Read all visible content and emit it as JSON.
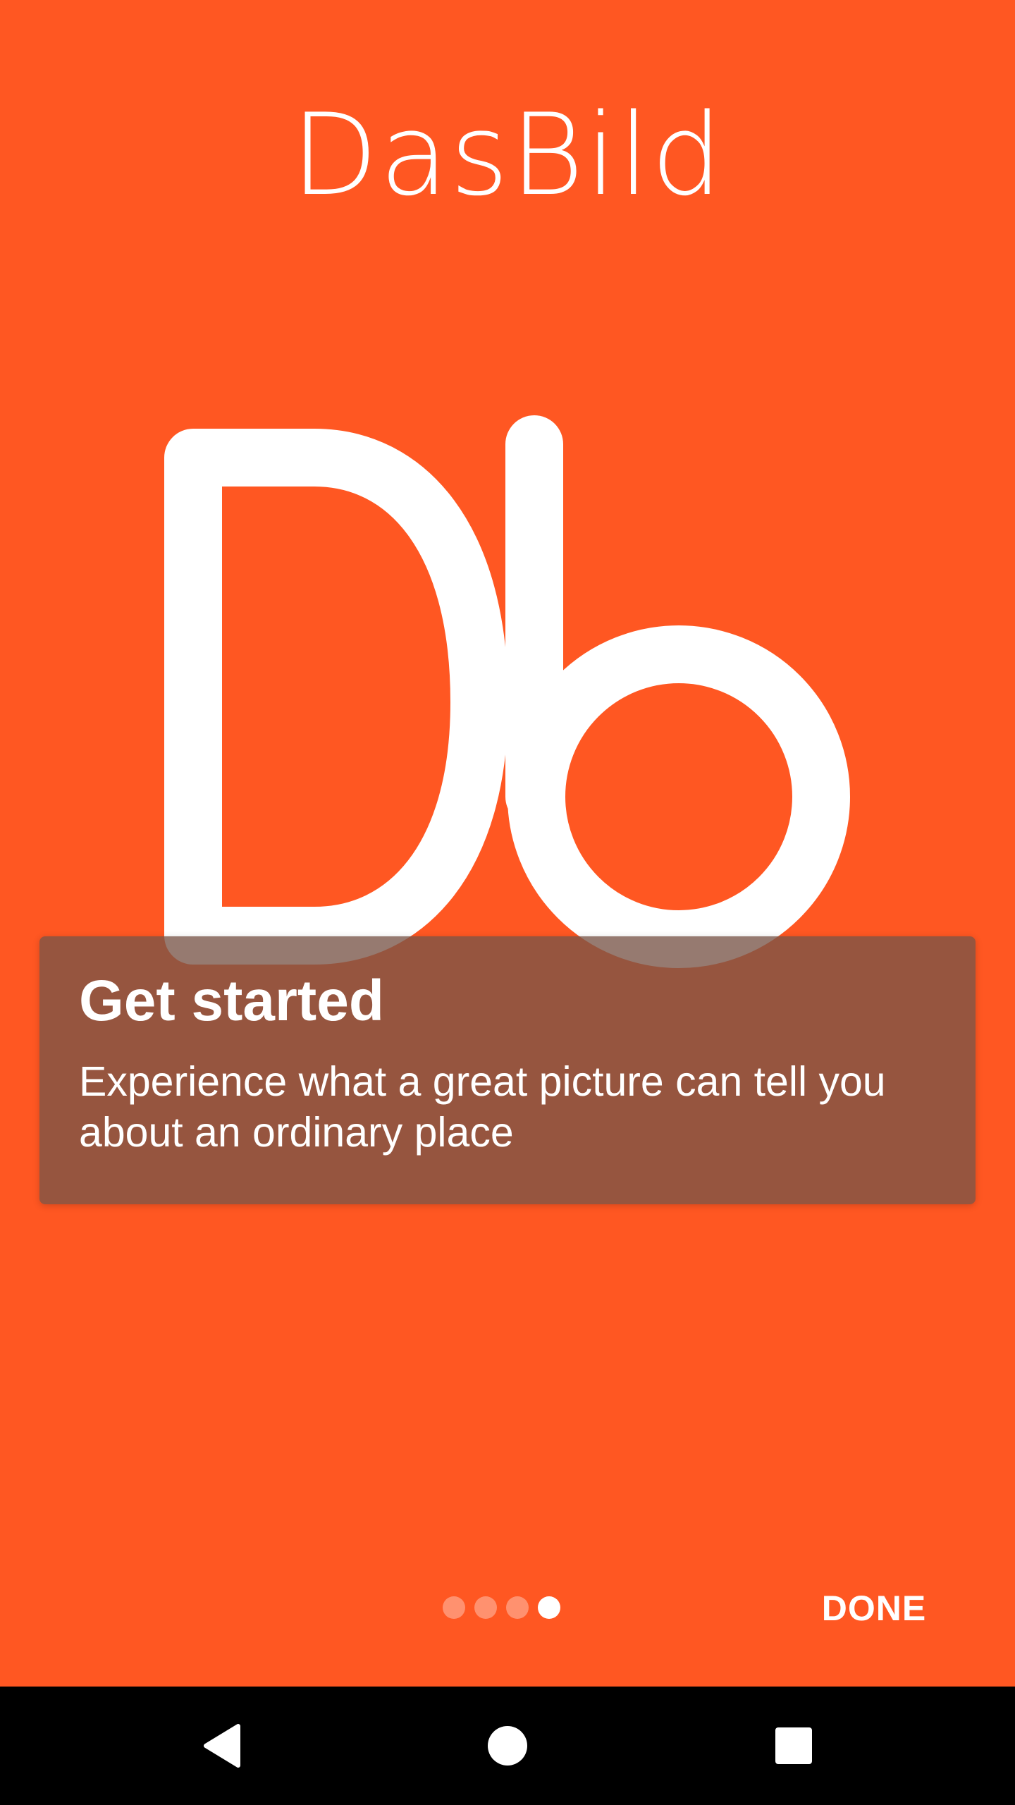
{
  "app": {
    "title": "DasBild"
  },
  "logo": {
    "icon": "dasbild-logo-icon",
    "color": "#FFFFFF"
  },
  "card": {
    "title": "Get started",
    "description": "Experience what a great picture can tell you about an ordinary place"
  },
  "pager": {
    "total": 4,
    "current": 4
  },
  "actions": {
    "done_label": "DONE"
  },
  "navigation": {
    "back_icon": "back-triangle-icon",
    "home_icon": "home-circle-icon",
    "recents_icon": "recents-square-icon"
  },
  "colors": {
    "background": "#FF5722",
    "card": "#785548",
    "text": "#FFFFFF",
    "nav_bar": "#000000"
  }
}
